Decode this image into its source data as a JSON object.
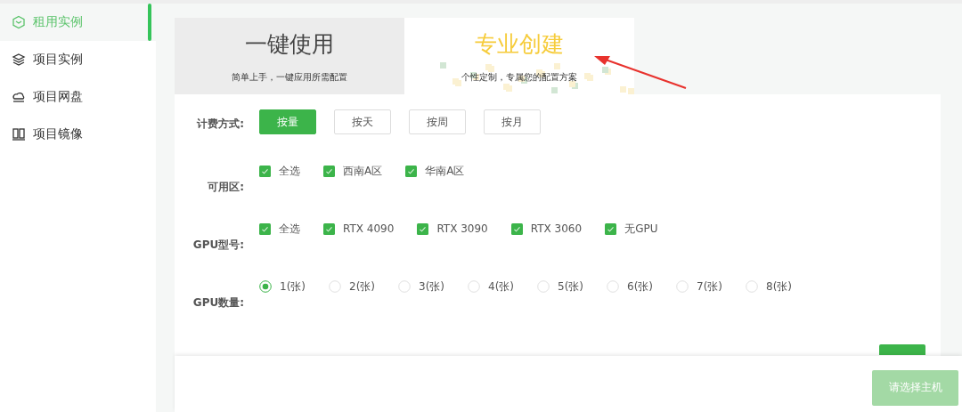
{
  "sidebar": {
    "items": [
      {
        "label": "租用实例",
        "selected": true
      },
      {
        "label": "项目实例",
        "selected": false
      },
      {
        "label": "项目网盘",
        "selected": false
      },
      {
        "label": "项目镜像",
        "selected": false
      }
    ]
  },
  "mode_tabs": [
    {
      "title": "一键使用",
      "subtitle": "简单上手，一键应用所需配置",
      "selected": false
    },
    {
      "title": "专业创建",
      "subtitle": "个性定制，专属您的配置方案",
      "selected": true
    }
  ],
  "billing": {
    "label": "计费方式:",
    "options": [
      {
        "label": "按量",
        "selected": true
      },
      {
        "label": "按天",
        "selected": false
      },
      {
        "label": "按周",
        "selected": false
      },
      {
        "label": "按月",
        "selected": false
      }
    ]
  },
  "zones": {
    "label": "可用区:",
    "options": [
      {
        "label": "全选",
        "checked": true
      },
      {
        "label": "西南A区",
        "checked": true
      },
      {
        "label": "华南A区",
        "checked": true
      }
    ]
  },
  "gpu_models": {
    "label": "GPU型号:",
    "options": [
      {
        "label": "全选",
        "checked": true
      },
      {
        "label": "RTX 4090",
        "checked": true
      },
      {
        "label": "RTX 3090",
        "checked": true
      },
      {
        "label": "RTX 3060",
        "checked": true
      },
      {
        "label": "无GPU",
        "checked": true
      }
    ]
  },
  "gpu_count": {
    "label": "GPU数量:",
    "options": [
      {
        "label": "1(张)",
        "selected": true
      },
      {
        "label": "2(张)",
        "selected": false
      },
      {
        "label": "3(张)",
        "selected": false
      },
      {
        "label": "4(张)",
        "selected": false
      },
      {
        "label": "5(张)",
        "selected": false
      },
      {
        "label": "6(张)",
        "selected": false
      },
      {
        "label": "7(张)",
        "selected": false
      },
      {
        "label": "8(张)",
        "selected": false
      }
    ]
  },
  "footer": {
    "submit_button": "请选择主机",
    "disabled": true
  }
}
